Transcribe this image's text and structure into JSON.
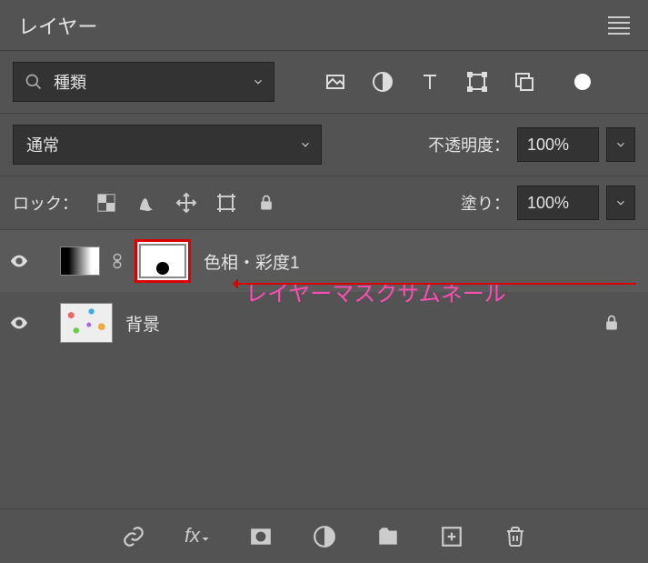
{
  "panel": {
    "title": "レイヤー"
  },
  "filter": {
    "kind": "種類"
  },
  "blend": {
    "mode": "通常",
    "opacity_label": "不透明度：",
    "opacity": "100%"
  },
  "lock": {
    "label": "ロック：",
    "fill_label": "塗り：",
    "fill": "100%"
  },
  "layers": [
    {
      "name": "色相・彩度1"
    },
    {
      "name": "背景"
    }
  ],
  "annotation": "レイヤーマスクサムネール"
}
